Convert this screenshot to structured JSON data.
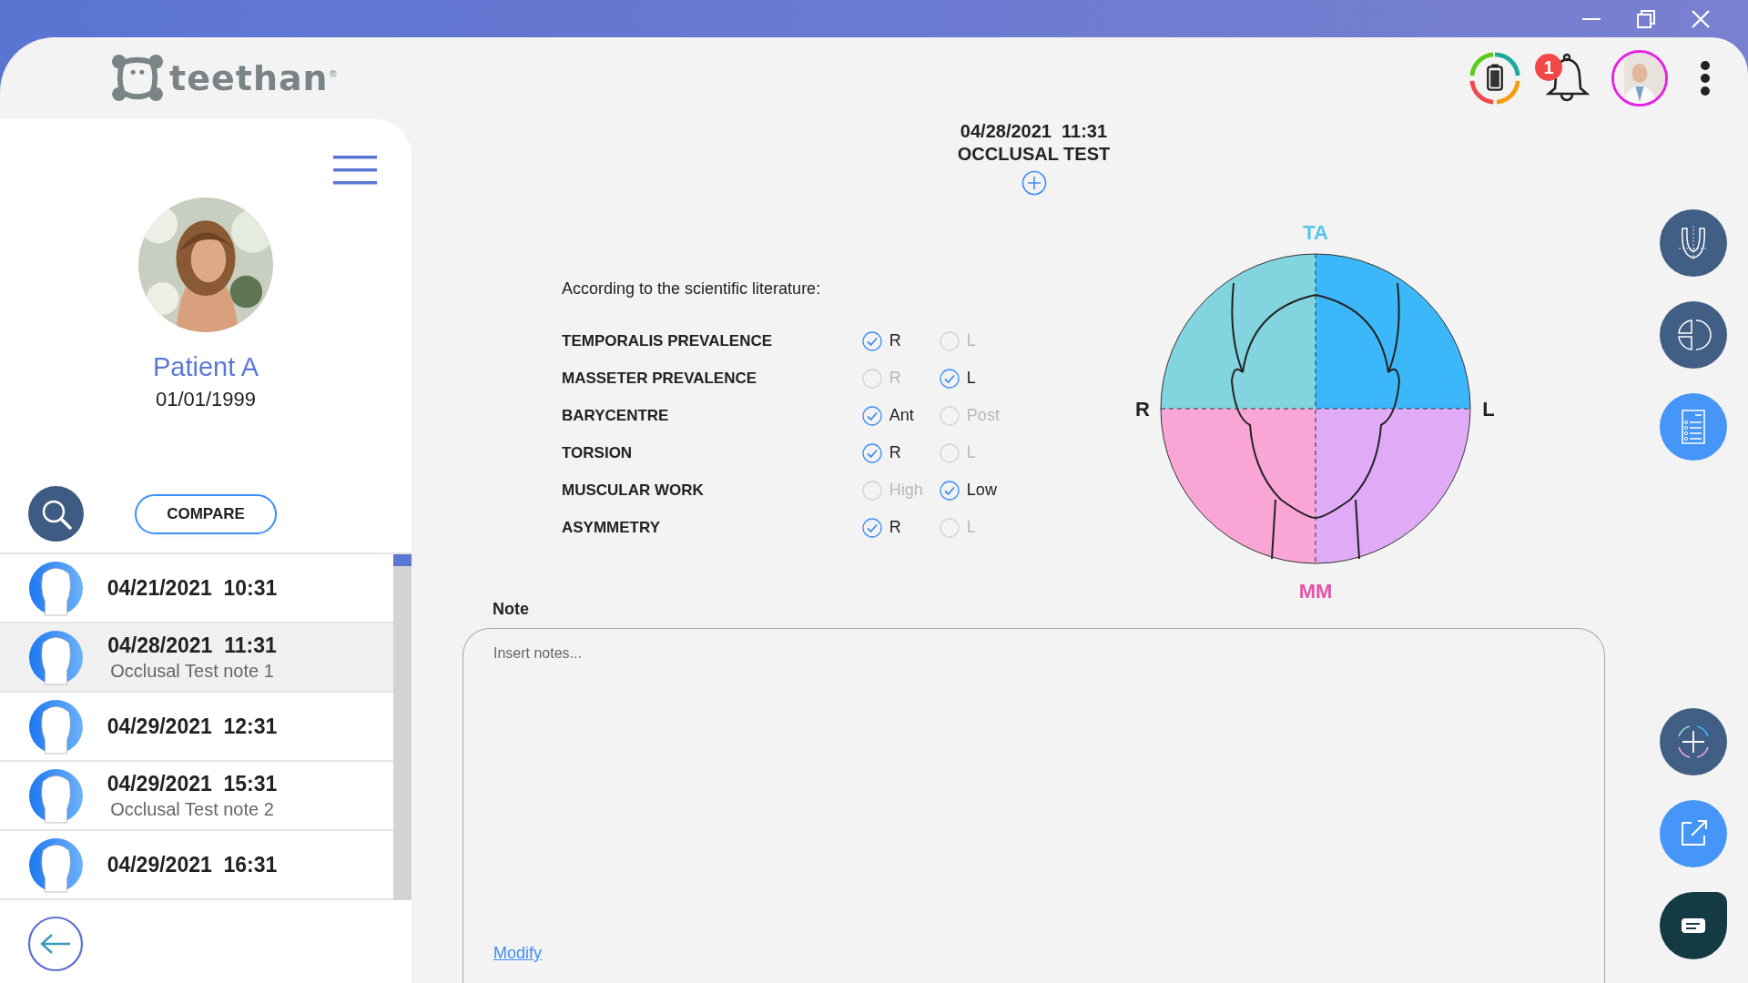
{
  "header": {
    "logo_text": "teethan",
    "logo_mark": "®",
    "notification_count": "1"
  },
  "sidebar": {
    "patient": {
      "name": "Patient A",
      "birthdate": "01/01/1999"
    },
    "compare_button": "COMPARE",
    "sessions": [
      {
        "date_time": "04/21/2021  10:31",
        "selected": false
      },
      {
        "date_time": "04/28/2021  11:31",
        "note": "Occlusal Test note 1",
        "selected": true
      },
      {
        "date_time": "04/29/2021  12:31",
        "selected": false
      },
      {
        "date_time": "04/29/2021  15:31",
        "note": "Occlusal Test note 2",
        "selected": false
      },
      {
        "date_time": "04/29/2021  16:31",
        "selected": false
      }
    ]
  },
  "test": {
    "date_time": "04/28/2021  11:31",
    "title": "OCCLUSAL TEST",
    "intro": "According to the scientific literature:",
    "findings": [
      {
        "label": "TEMPORALIS PREVALENCE",
        "options": [
          {
            "label": "R",
            "checked": true
          },
          {
            "label": "L",
            "checked": false
          }
        ]
      },
      {
        "label": "MASSETER PREVALENCE",
        "options": [
          {
            "label": "R",
            "checked": false
          },
          {
            "label": "L",
            "checked": true
          }
        ]
      },
      {
        "label": "BARYCENTRE",
        "options": [
          {
            "label": "Ant",
            "checked": true
          },
          {
            "label": "Post",
            "checked": false
          }
        ]
      },
      {
        "label": "TORSION",
        "options": [
          {
            "label": "R",
            "checked": true
          },
          {
            "label": "L",
            "checked": false
          }
        ]
      },
      {
        "label": "MUSCULAR WORK",
        "options": [
          {
            "label": "High",
            "checked": false
          },
          {
            "label": "Low",
            "checked": true
          }
        ]
      },
      {
        "label": "ASYMMETRY",
        "options": [
          {
            "label": "R",
            "checked": true
          },
          {
            "label": "L",
            "checked": false
          }
        ]
      }
    ],
    "diagram": {
      "top": "TA",
      "bottom": "MM",
      "left": "R",
      "right": "L"
    }
  },
  "note": {
    "label": "Note",
    "placeholder": "Insert notes...",
    "link": "Modify"
  }
}
